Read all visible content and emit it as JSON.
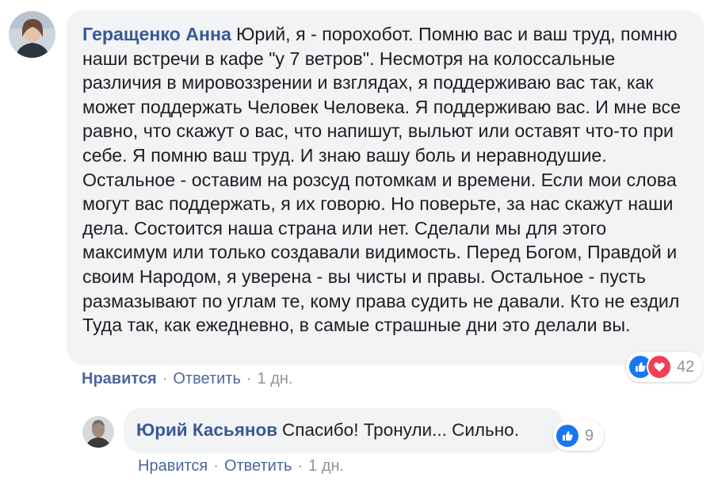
{
  "comment": {
    "author": "Геращенко Анна",
    "text": "Юрий, я - порохобот. Помню вас и ваш труд, помню наши встречи в кафе \"у 7 ветров\". Несмотря на колоссальные различия в мировоззрении и взглядах, я поддерживаю вас так, как может поддержать Человек Человека. Я поддерживаю вас. И мне все равно, что скажут о вас, что напишут, выльют или оставят что-то при себе. Я помню ваш труд. И знаю вашу боль и неравнодушие. Остальное - оставим на розсуд потомкам и времени. Если мои слова могут вас поддержать, я их говорю. Но поверьте, за нас скажут наши дела. Состоится наша страна или нет. Сделали мы для этого максимум или только создавали видимость. Перед Богом, Правдой и своим Народом, я уверена - вы чисты и правы. Остальное - пусть размазывают по углам те, кому права судить не давали. Кто не ездил Туда так, как ежедневно, в самые страшные дни это делали вы.",
    "like_label": "Нравится",
    "reply_label": "Ответить",
    "time": "1 дн.",
    "separator": "·",
    "reactions": {
      "count": "42",
      "icons": [
        "like-icon",
        "love-icon"
      ]
    }
  },
  "reply": {
    "author": "Юрий Касьянов",
    "text": "Спасибо! Тронули... Сильно.",
    "like_label": "Нравится",
    "reply_label": "Ответить",
    "time": "1 дн.",
    "separator": "·",
    "reactions": {
      "count": "9",
      "icons": [
        "like-icon"
      ]
    }
  },
  "colors": {
    "author": "#385898",
    "bubble": "#f2f3f5",
    "like_blue": "#1877f2",
    "love_red": "#f33e58",
    "muted": "#90949c"
  }
}
